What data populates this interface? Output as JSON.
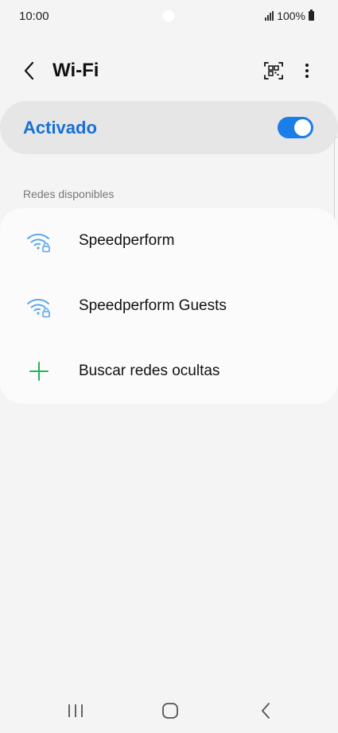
{
  "status_bar": {
    "time": "10:00",
    "battery": "100%"
  },
  "header": {
    "title": "Wi-Fi",
    "back_icon": "chevron-left-icon",
    "qr_icon": "qr-code-scan-icon",
    "more_icon": "more-vertical-icon"
  },
  "master_switch": {
    "label": "Activado",
    "state": "on",
    "accent_color": "#1a7ee8"
  },
  "networks": {
    "section_label": "Redes disponibles",
    "items": [
      {
        "label": "Speedperform",
        "icon": "wifi-lock-icon"
      },
      {
        "label": "Speedperform Guests",
        "icon": "wifi-lock-icon"
      },
      {
        "label": "Buscar redes ocultas",
        "icon": "plus-icon"
      }
    ]
  },
  "nav_bar": {
    "recent_icon": "recent-apps-icon",
    "home_icon": "home-icon",
    "back_icon": "back-icon"
  }
}
